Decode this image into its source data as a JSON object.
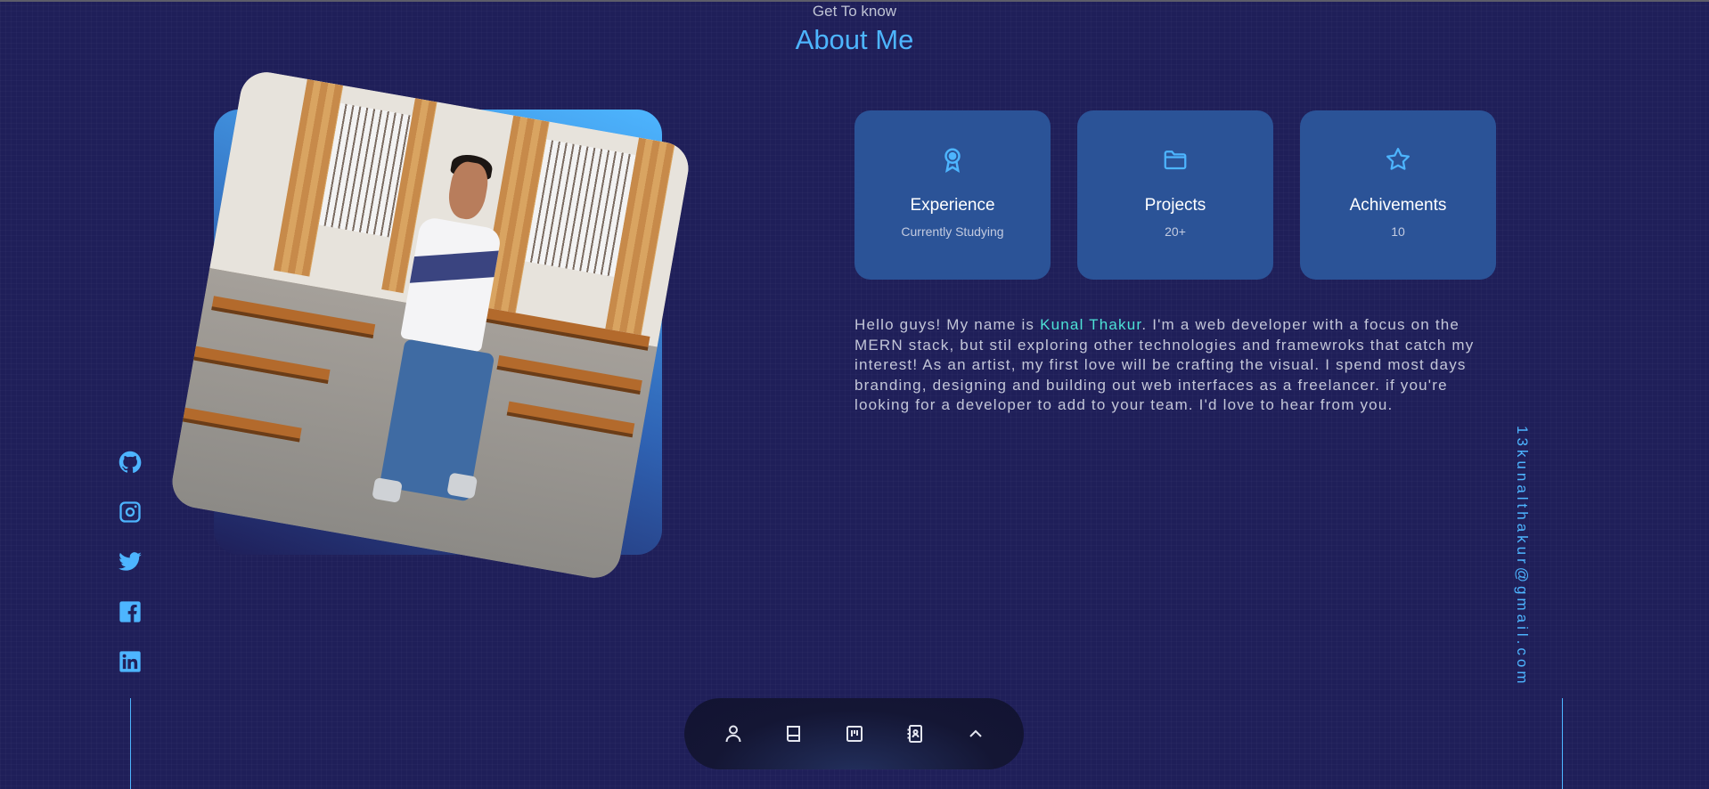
{
  "header": {
    "subtitle": "Get To know",
    "title": "About Me"
  },
  "social": [
    {
      "name": "github",
      "icon": "github-icon"
    },
    {
      "name": "instagram",
      "icon": "instagram-icon"
    },
    {
      "name": "twitter",
      "icon": "twitter-icon"
    },
    {
      "name": "facebook",
      "icon": "facebook-icon"
    },
    {
      "name": "linkedin",
      "icon": "linkedin-icon"
    }
  ],
  "email": "13kunalthakur@gmail.com",
  "cards": [
    {
      "icon": "award-icon",
      "title": "Experience",
      "subtitle": "Currently Studying"
    },
    {
      "icon": "folder-icon",
      "title": "Projects",
      "subtitle": "20+"
    },
    {
      "icon": "star-icon",
      "title": "Achivements",
      "subtitle": "10"
    }
  ],
  "about": {
    "before": "Hello guys! My name is ",
    "name": "Kunal Thakur",
    "after": ". I'm a web developer with a focus on the MERN stack, but stil exploring other technologies and framewroks that catch my interest! As an artist, my first love will be crafting the visual. I spend most days branding, designing and building out web interfaces as a freelancer. if you're looking for a developer to add to your team. I'd love to hear from you."
  },
  "nav": [
    {
      "icon": "user-icon"
    },
    {
      "icon": "book-icon"
    },
    {
      "icon": "kanban-icon"
    },
    {
      "icon": "contact-book-icon"
    },
    {
      "icon": "chevron-up-icon"
    }
  ],
  "colors": {
    "background": "#1f1f59",
    "accent": "#4db5ff",
    "card": "#2b5397",
    "highlight": "#4de2d6"
  }
}
